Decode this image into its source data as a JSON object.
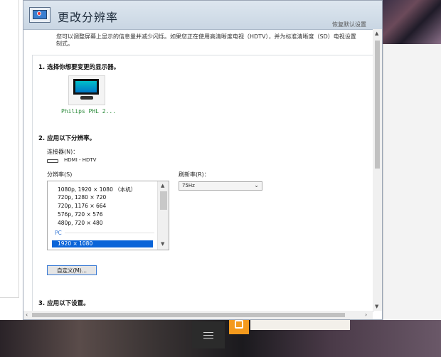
{
  "window": {
    "title": "更改分辨率",
    "restore_defaults": "恢复默认设置",
    "description_line1": "您可以调整屏幕上显示的信息量并减少闪烁。如果您正在使用高清晰度电视（HDTV），并为标准清晰度（SD）电视设置",
    "description_line2": "制式。"
  },
  "section1": {
    "title": "1. 选择你想要变更的显示器。",
    "monitor_label": "Philips PHL 2..."
  },
  "section2": {
    "title": "2. 应用以下分辨率。",
    "connector_label": "连接器(N)：",
    "connector_value": "HDMI - HDTV",
    "resolution_label": "分辨率(S)",
    "refresh_label": "刷新率(R)：",
    "refresh_value": "75Hz",
    "resolutions": [
      "1080p, 1920 × 1080 （本机）",
      "720p, 1280 × 720",
      "720p, 1176 × 664",
      "576p, 720 × 576",
      "480p, 720 × 480"
    ],
    "group_pc": "PC",
    "selected_resolution": "1920 × 1080",
    "custom_button": "自定义(M)..."
  },
  "section3": {
    "title": "3. 应用以下设置。"
  },
  "colors": {
    "accent": "#0a64d8",
    "header_bg": "#c9d6e3",
    "taskbar_orange": "#f49a1d"
  },
  "icons": [
    "display-settings-icon",
    "monitor-icon",
    "hdmi-connector-icon",
    "chevron-down-icon",
    "hamburger-icon"
  ]
}
